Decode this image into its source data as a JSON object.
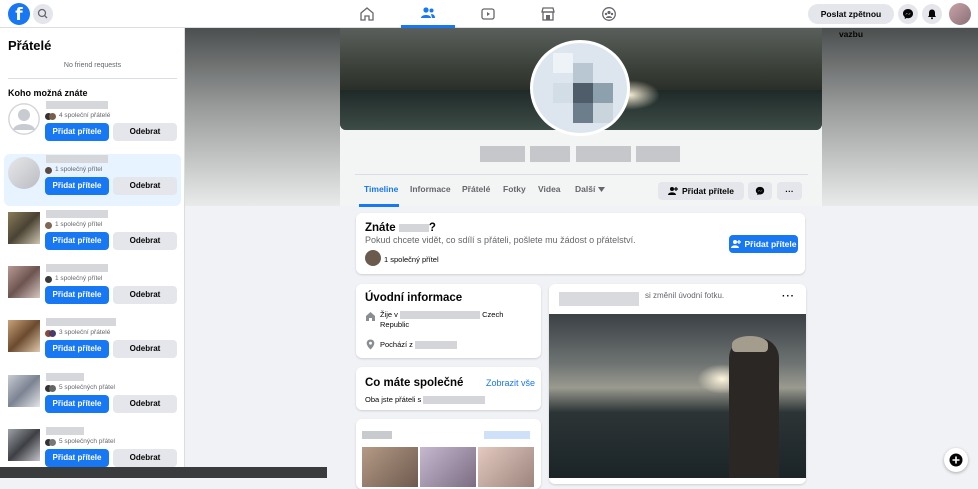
{
  "topbar": {
    "logo_letter": "f",
    "feedback_label": "Poslat zpětnou vazbu",
    "icons": [
      "home-icon",
      "friends-icon",
      "watch-icon",
      "marketplace-icon",
      "groups-icon"
    ],
    "accent": "#1877f2"
  },
  "sidebar": {
    "title": "Přátelé",
    "no_requests": "No friend requests",
    "suggestions_title": "Koho možná znáte",
    "add_label": "Přidat přítele",
    "remove_label": "Odebrat",
    "people": [
      {
        "mutual": "4 společní přátelé"
      },
      {
        "mutual": "1 společný přítel"
      },
      {
        "mutual": "1 společný přítel"
      },
      {
        "mutual": "1 společný přítel"
      },
      {
        "mutual": "3 společní přátelé"
      },
      {
        "mutual": "5 společných přátel"
      },
      {
        "mutual": "5 společných přátel"
      }
    ]
  },
  "profile": {
    "tabs": [
      "Timeline",
      "Informace",
      "Přátelé",
      "Fotky",
      "Videa",
      "Další"
    ],
    "add_friend_label": "Přidat přítele",
    "more_label": "···"
  },
  "know_card": {
    "title_prefix": "Znáte",
    "title_suffix": "?",
    "description": "Pokud chcete vidět, co sdílí s přáteli, pošlete mu žádost o přátelství.",
    "mutual": "1 společný přítel",
    "add_label": "Přidat přítele"
  },
  "intro_card": {
    "title": "Úvodní informace",
    "lives_prefix": "Žije v",
    "lives_country": "Czech",
    "lives_country2": "Republic",
    "from_prefix": "Pochází z"
  },
  "common_card": {
    "title": "Co máte společné",
    "link": "Zobrazit vše",
    "friends_prefix": "Oba jste přáteli s"
  },
  "post": {
    "text": "si změnil úvodní fotku.",
    "menu": "···"
  }
}
